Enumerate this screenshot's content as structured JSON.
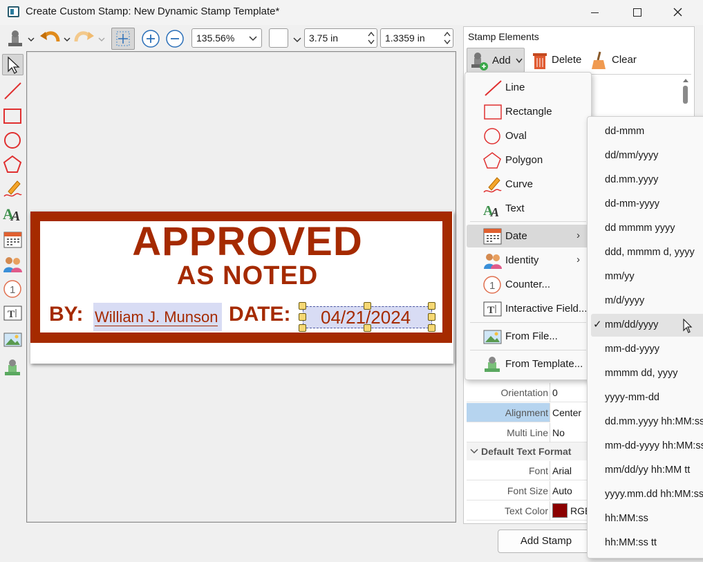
{
  "window": {
    "title": "Create Custom Stamp: New Dynamic Stamp Template*"
  },
  "toolbar": {
    "zoom_value": "135.56%",
    "width_value": "3.75 in",
    "height_value": "1.3359 in"
  },
  "stamp": {
    "title": "APPROVED",
    "subtitle": "AS NOTED",
    "by_label": "BY:",
    "name": "William J. Munson",
    "date_label": "DATE:",
    "date": "04/21/2024",
    "color": "#a52a00"
  },
  "panel": {
    "title": "Stamp Elements",
    "add_label": "Add",
    "delete_label": "Delete",
    "clear_label": "Clear",
    "properties": [
      {
        "key": "Orientation",
        "value": "0"
      },
      {
        "key": "Alignment",
        "value": "Center"
      },
      {
        "key": "Multi Line",
        "value": "No"
      }
    ],
    "section_label": "Default Text Format",
    "text_props": [
      {
        "key": "Font",
        "value": "Arial"
      },
      {
        "key": "Font Size",
        "value": "Auto"
      },
      {
        "key": "Text Color",
        "value": "RGB"
      }
    ],
    "text_color_swatch": "#8b0000",
    "add_stamp_label": "Add Stamp"
  },
  "add_menu": {
    "items": [
      {
        "label": "Line"
      },
      {
        "label": "Rectangle"
      },
      {
        "label": "Oval"
      },
      {
        "label": "Polygon"
      },
      {
        "label": "Curve"
      },
      {
        "label": "Text"
      },
      {
        "label": "Date"
      },
      {
        "label": "Identity"
      },
      {
        "label": "Counter..."
      },
      {
        "label": "Interactive Field..."
      },
      {
        "label": "From File..."
      },
      {
        "label": "From Template..."
      }
    ]
  },
  "date_menu": {
    "formats": [
      "dd-mmm",
      "dd/mm/yyyy",
      "dd.mm.yyyy",
      "dd-mm-yyyy",
      "dd mmmm yyyy",
      "ddd, mmmm d, yyyy",
      "mm/yy",
      "m/d/yyyy",
      "mm/dd/yyyy",
      "mm-dd-yyyy",
      "mmmm dd, yyyy",
      "yyyy-mm-dd",
      "dd.mm.yyyy hh:MM:ss",
      "mm-dd-yyyy hh:MM:ss",
      "mm/dd/yy hh:MM tt",
      "yyyy.mm.dd hh:MM:ss",
      "hh:MM:ss",
      "hh:MM:ss tt"
    ],
    "selected": "mm/dd/yyyy"
  }
}
